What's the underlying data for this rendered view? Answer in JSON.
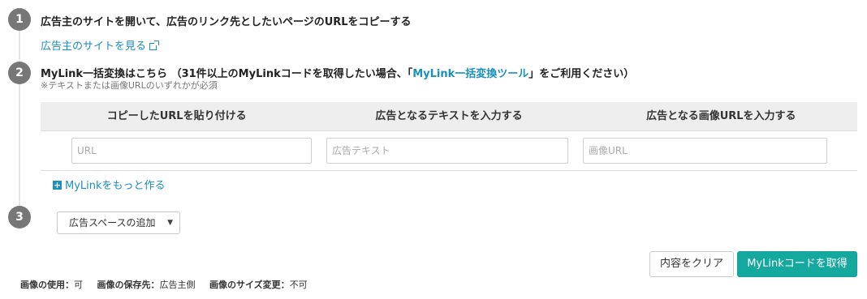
{
  "steps": {
    "one": {
      "number": "1",
      "title": "広告主のサイトを開いて、広告のリンク先としたいページのURLをコピーする",
      "link": "広告主のサイトを見る"
    },
    "two": {
      "number": "2",
      "title_prefix": "MyLink一括変換はこちら （31件以上のMyLinkコードを取得したい場合、「",
      "title_link": "MyLink一括変換ツール",
      "title_suffix": "」をご利用ください）",
      "note": "※テキストまたは画像URLのいずれかが必須"
    },
    "three": {
      "number": "3",
      "select_value": "広告スペースの追加"
    }
  },
  "table": {
    "headers": [
      "コピーしたURLを貼り付ける",
      "広告となるテキストを入力する",
      "広告となる画像URLを入力する"
    ],
    "placeholders": {
      "url": "URL",
      "text": "広告テキスト",
      "image": "画像URL"
    }
  },
  "more_link": "MyLinkをもっと作る",
  "buttons": {
    "clear": "内容をクリア",
    "get": "MyLinkコードを取得"
  },
  "footer": {
    "usage_label": "画像の使用：",
    "usage_value": "可",
    "storage_label": "画像の保存先：",
    "storage_value": "広告主側",
    "resize_label": "画像のサイズ変更：",
    "resize_value": "不可"
  },
  "colors": {
    "accent": "#1a8fc0",
    "primary_button": "#14a89e",
    "step_circle": "#777777"
  }
}
